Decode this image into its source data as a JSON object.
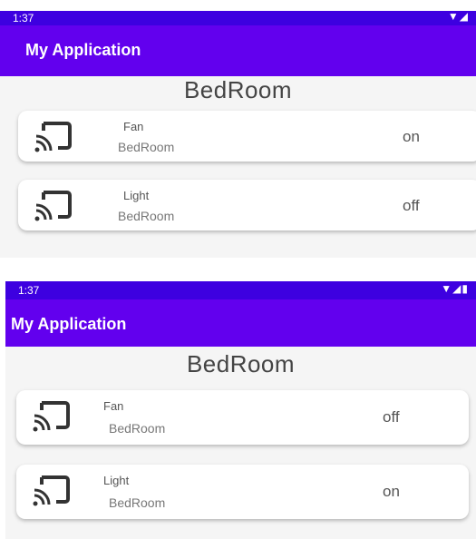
{
  "screens": [
    {
      "status_time": "1:37",
      "app_title": "My Application",
      "room_title": "BedRoom",
      "devices": [
        {
          "name": "Fan",
          "room": "BedRoom",
          "state": "on",
          "icon": "cast-icon"
        },
        {
          "name": "Light",
          "room": "BedRoom",
          "state": "off",
          "icon": "cast-icon"
        }
      ]
    },
    {
      "status_time": "1:37",
      "app_title": "My Application",
      "room_title": "BedRoom",
      "devices": [
        {
          "name": "Fan",
          "room": "BedRoom",
          "state": "off",
          "icon": "cast-icon"
        },
        {
          "name": "Light",
          "room": "BedRoom",
          "state": "on",
          "icon": "cast-icon"
        }
      ]
    }
  ],
  "colors": {
    "status_bar": "#3d00e0",
    "app_bar": "#6200ee"
  }
}
